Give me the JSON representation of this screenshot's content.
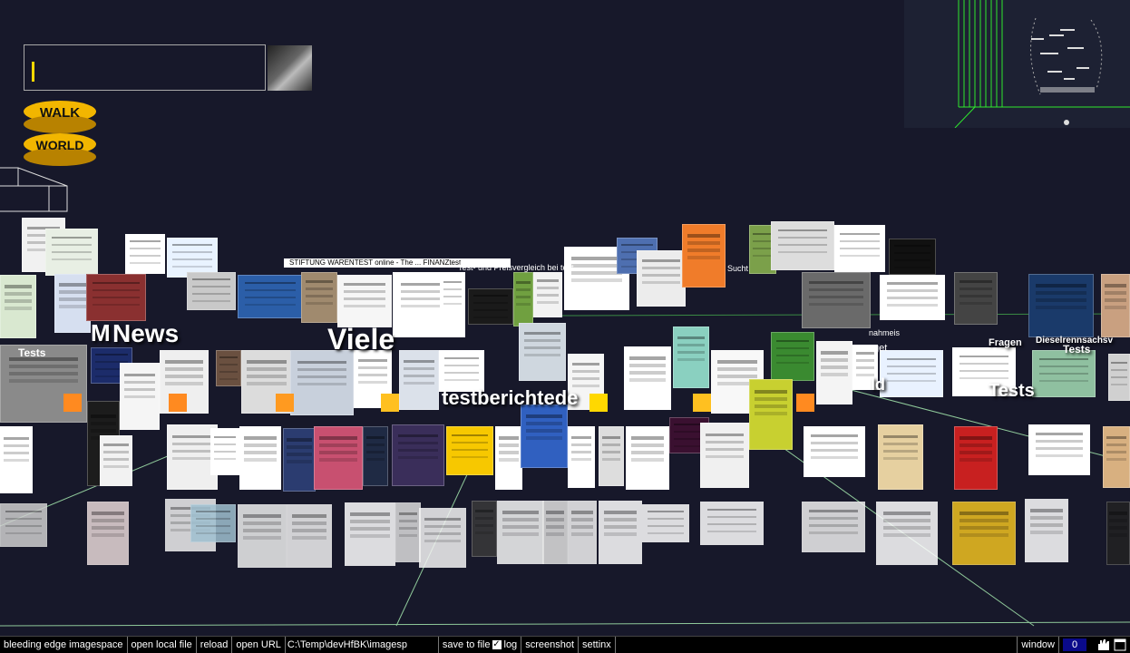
{
  "app": {
    "title": "bleeding edge imagespace"
  },
  "status_bar": {
    "items": [
      "bleeding edge imagespace",
      "open local file",
      "reload",
      "open URL"
    ],
    "path": "C:\\Temp\\devHfBK\\imagesp",
    "save_label": "save to file",
    "save_checked": true,
    "log_label": "log",
    "screenshot_label": "screenshot",
    "settings_label": "settinx",
    "window_label": "window",
    "window_value": "0"
  },
  "search": {
    "value": ""
  },
  "logo": {
    "line1": "WALK",
    "line2": "WORLD"
  },
  "scene": {
    "words": [
      "M",
      "News",
      "Viele",
      "testberichtede",
      "Tests",
      "Fragen",
      "Tests",
      "Dieselrennsachsv"
    ],
    "small_labels": [
      "Sucht",
      "nahmeis",
      "get",
      "ld",
      "Tests"
    ],
    "banner": "STIFTUNG WARENTEST online - The ... FINANZtest",
    "banner_sub": "Test- und Preisvergleich bei test..."
  },
  "colors": {
    "background": "#17182a",
    "accent": "#ffd800",
    "status_bg": "#000000",
    "minimap_line": "#2ee82e"
  },
  "icons": [
    "search-icon",
    "hand-icon",
    "window-icon",
    "checkbox-icon"
  ]
}
